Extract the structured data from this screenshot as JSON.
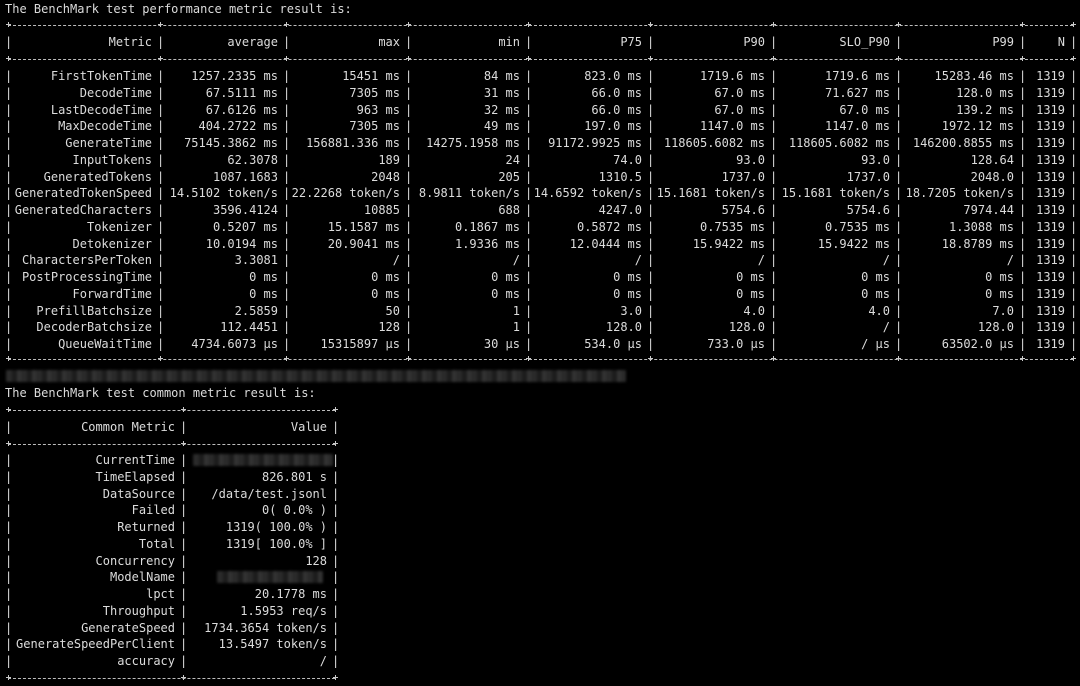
{
  "perf": {
    "heading": "The BenchMark test performance metric result is:",
    "headers": [
      "Metric",
      "average",
      "max",
      "min",
      "P75",
      "P90",
      "SLO_P90",
      "P99",
      "N"
    ],
    "rows": [
      [
        "FirstTokenTime",
        "1257.2335 ms",
        "15451 ms",
        "84 ms",
        "823.0 ms",
        "1719.6 ms",
        "1719.6 ms",
        "15283.46 ms",
        "1319"
      ],
      [
        "DecodeTime",
        "67.5111 ms",
        "7305 ms",
        "31 ms",
        "66.0 ms",
        "67.0 ms",
        "71.627 ms",
        "128.0 ms",
        "1319"
      ],
      [
        "LastDecodeTime",
        "67.6126 ms",
        "963 ms",
        "32 ms",
        "66.0 ms",
        "67.0 ms",
        "67.0 ms",
        "139.2 ms",
        "1319"
      ],
      [
        "MaxDecodeTime",
        "404.2722 ms",
        "7305 ms",
        "49 ms",
        "197.0 ms",
        "1147.0 ms",
        "1147.0 ms",
        "1972.12 ms",
        "1319"
      ],
      [
        "GenerateTime",
        "75145.3862 ms",
        "156881.336 ms",
        "14275.1958 ms",
        "91172.9925 ms",
        "118605.6082 ms",
        "118605.6082 ms",
        "146200.8855 ms",
        "1319"
      ],
      [
        "InputTokens",
        "62.3078",
        "189",
        "24",
        "74.0",
        "93.0",
        "93.0",
        "128.64",
        "1319"
      ],
      [
        "GeneratedTokens",
        "1087.1683",
        "2048",
        "205",
        "1310.5",
        "1737.0",
        "1737.0",
        "2048.0",
        "1319"
      ],
      [
        "GeneratedTokenSpeed",
        "14.5102 token/s",
        "22.2268 token/s",
        "8.9811 token/s",
        "14.6592 token/s",
        "15.1681 token/s",
        "15.1681 token/s",
        "18.7205 token/s",
        "1319"
      ],
      [
        "GeneratedCharacters",
        "3596.4124",
        "10885",
        "688",
        "4247.0",
        "5754.6",
        "5754.6",
        "7974.44",
        "1319"
      ],
      [
        "Tokenizer",
        "0.5207 ms",
        "15.1587 ms",
        "0.1867 ms",
        "0.5872 ms",
        "0.7535 ms",
        "0.7535 ms",
        "1.3088 ms",
        "1319"
      ],
      [
        "Detokenizer",
        "10.0194 ms",
        "20.9041 ms",
        "1.9336 ms",
        "12.0444 ms",
        "15.9422 ms",
        "15.9422 ms",
        "18.8789 ms",
        "1319"
      ],
      [
        "CharactersPerToken",
        "3.3081",
        "/",
        "/",
        "/",
        "/",
        "/",
        "/",
        "1319"
      ],
      [
        "PostProcessingTime",
        "0 ms",
        "0 ms",
        "0 ms",
        "0 ms",
        "0 ms",
        "0 ms",
        "0 ms",
        "1319"
      ],
      [
        "ForwardTime",
        "0 ms",
        "0 ms",
        "0 ms",
        "0 ms",
        "0 ms",
        "0 ms",
        "0 ms",
        "1319"
      ],
      [
        "PrefillBatchsize",
        "2.5859",
        "50",
        "1",
        "3.0",
        "4.0",
        "4.0",
        "7.0",
        "1319"
      ],
      [
        "DecoderBatchsize",
        "112.4451",
        "128",
        "1",
        "128.0",
        "128.0",
        "/",
        "128.0",
        "1319"
      ],
      [
        "QueueWaitTime",
        "4734.6073 µs",
        "15315897 µs",
        "30 µs",
        "534.0 µs",
        "733.0 µs",
        "/ µs",
        "63502.0 µs",
        "1319"
      ]
    ]
  },
  "common": {
    "heading": "The BenchMark test common metric result is:",
    "headers": [
      "Common Metric",
      "Value"
    ],
    "rows": [
      [
        "CurrentTime",
        ""
      ],
      [
        "TimeElapsed",
        "826.801 s"
      ],
      [
        "DataSource",
        "/data/test.jsonl"
      ],
      [
        "Failed",
        "0( 0.0% )"
      ],
      [
        "Returned",
        "1319( 100.0% )"
      ],
      [
        "Total",
        "1319[ 100.0% ]"
      ],
      [
        "Concurrency",
        "128"
      ],
      [
        "ModelName",
        ""
      ],
      [
        "lpct",
        "20.1778 ms"
      ],
      [
        "Throughput",
        "1.5953 req/s"
      ],
      [
        "GenerateSpeed",
        "1734.3654 token/s"
      ],
      [
        "GenerateSpeedPerClient",
        "13.5497 token/s"
      ],
      [
        "accuracy",
        "/"
      ]
    ]
  }
}
